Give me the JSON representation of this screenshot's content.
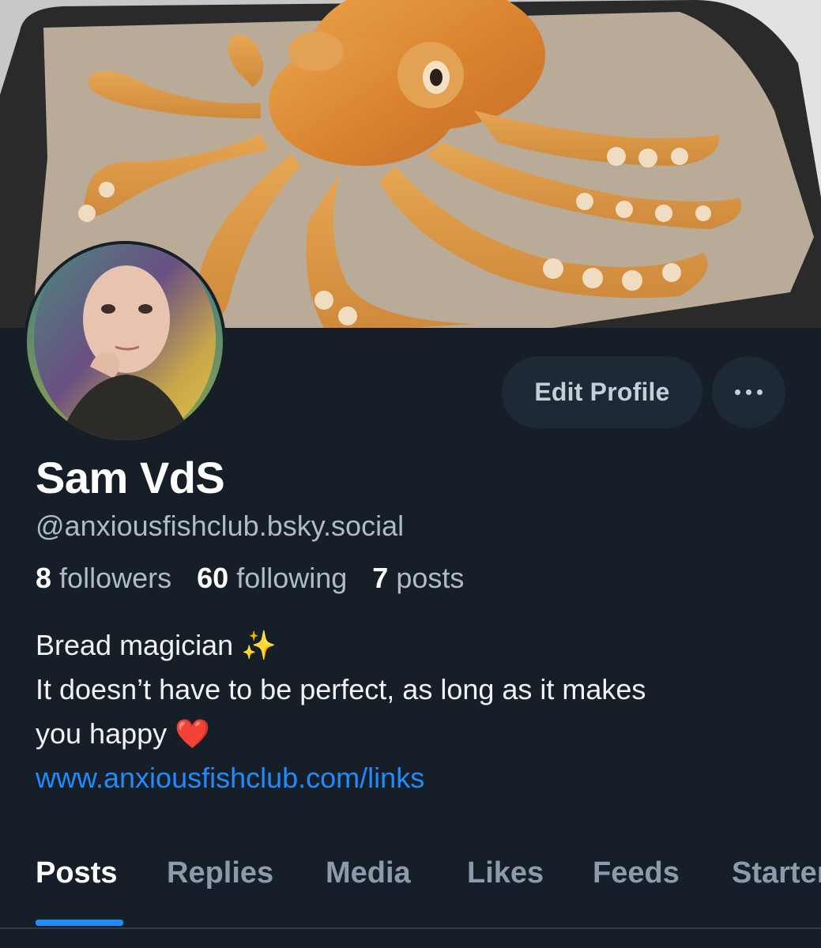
{
  "profile": {
    "display_name": "Sam VdS",
    "handle": "@anxiousfishclub.bsky.social"
  },
  "stats": {
    "followers_count": "8",
    "followers_label": "followers",
    "following_count": "60",
    "following_label": "following",
    "posts_count": "7",
    "posts_label": "posts"
  },
  "bio": {
    "line1": "Bread magician",
    "line1_emoji": "✨",
    "line2": "It doesn’t have to be perfect, as long as it makes",
    "line3": "you happy",
    "line3_emoji": "❤️",
    "link": "www.anxiousfishclub.com/links"
  },
  "actions": {
    "edit_profile": "Edit Profile",
    "more_icon": "more-horizontal-icon"
  },
  "tabs": [
    {
      "label": "Posts",
      "active": true
    },
    {
      "label": "Replies",
      "active": false
    },
    {
      "label": "Media",
      "active": false
    },
    {
      "label": "Likes",
      "active": false
    },
    {
      "label": "Feeds",
      "active": false
    },
    {
      "label": "Starter Packs",
      "active": false
    }
  ],
  "colors": {
    "background": "#161e27",
    "accent": "#208bfe",
    "button_bg": "#1e2936",
    "muted_text": "#aebbc9"
  }
}
